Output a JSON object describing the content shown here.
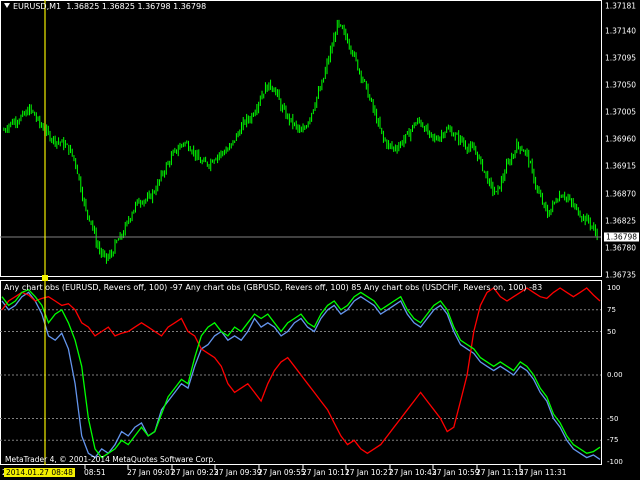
{
  "chart_header": {
    "symbol": "EURUSD,M1",
    "ohlc": "1.36825 1.36825 1.36798 1.36798"
  },
  "indicator_header": {
    "text": "Any chart obs (EURUSD, Revers off, 100) -97  Any chart obs (GBPUSD, Revers off, 100) 85  Any chart obs (USDCHF, Revers on, 100) -83"
  },
  "footer": {
    "copyright": "MetaTrader 4, © 2001-2014 MetaQuotes Software Corp."
  },
  "colors": {
    "background": "#000000",
    "grid": "#808080",
    "bull_candle": "#00ff00",
    "crosshair": "#f4f000",
    "eurusd_line": "#6495ed",
    "gbpusd_line": "#ff0000",
    "usdchf_line": "#00ff00"
  },
  "chart_data": [
    {
      "type": "candlestick",
      "title": "",
      "y_ticks": [
        "1.37181",
        "1.37140",
        "1.37095",
        "1.37050",
        "1.37005",
        "1.36960",
        "1.36915",
        "1.36870",
        "1.36825",
        "1.36780",
        "1.36735"
      ],
      "current_price": "1.36798",
      "ylim": [
        1.36735,
        1.37181
      ],
      "close_path": [
        1.36975,
        1.36985,
        1.3699,
        1.36995,
        1.37,
        1.3701,
        1.37,
        1.36985,
        1.36975,
        1.36965,
        1.36958,
        1.36955,
        1.3695,
        1.3694,
        1.3692,
        1.3688,
        1.3684,
        1.36825,
        1.3679,
        1.3677,
        1.36762,
        1.3677,
        1.3679,
        1.368,
        1.3682,
        1.3684,
        1.36855,
        1.3686,
        1.3686,
        1.3687,
        1.36885,
        1.36905,
        1.3692,
        1.36935,
        1.36945,
        1.36955,
        1.3695,
        1.3694,
        1.36925,
        1.3692,
        1.3692,
        1.3693,
        1.36935,
        1.3694,
        1.36945,
        1.3696,
        1.36975,
        1.3699,
        1.36995,
        1.3701,
        1.3703,
        1.37045,
        1.3705,
        1.3704,
        1.37015,
        1.37,
        1.3699,
        1.3698,
        1.3697,
        1.36985,
        1.37005,
        1.3703,
        1.3705,
        1.37085,
        1.37115,
        1.3715,
        1.3714,
        1.37125,
        1.37105,
        1.3708,
        1.3706,
        1.37035,
        1.3701,
        1.36985,
        1.3696,
        1.3695,
        1.36945,
        1.3695,
        1.3696,
        1.3697,
        1.36985,
        1.3699,
        1.3698,
        1.36965,
        1.3696,
        1.36965,
        1.36975,
        1.36975,
        1.36965,
        1.3696,
        1.3695,
        1.36945,
        1.3694,
        1.3692,
        1.369,
        1.3688,
        1.3687,
        1.3689,
        1.36915,
        1.3693,
        1.3695,
        1.36945,
        1.36935,
        1.36905,
        1.36875,
        1.36855,
        1.36835,
        1.3685,
        1.36865,
        1.3687,
        1.3686,
        1.3685,
        1.3684,
        1.3683,
        1.36825,
        1.3681,
        1.36798
      ]
    },
    {
      "type": "line",
      "title": "",
      "y_ticks": [
        "100",
        "75",
        "50",
        "0.00",
        "-50",
        "-75",
        "-100"
      ],
      "ylim": [
        -100,
        100
      ],
      "series": [
        {
          "name": "Any chart obs (EURUSD, Revers off, 100)",
          "values": [
            85,
            75,
            80,
            90,
            95,
            85,
            70,
            45,
            40,
            48,
            30,
            -10,
            -70,
            -90,
            -95,
            -85,
            -90,
            -80,
            -65,
            -70,
            -60,
            -55,
            -70,
            -65,
            -40,
            -30,
            -20,
            -10,
            -15,
            10,
            30,
            35,
            45,
            50,
            40,
            45,
            40,
            50,
            65,
            55,
            60,
            55,
            45,
            50,
            60,
            65,
            55,
            50,
            65,
            75,
            80,
            70,
            75,
            85,
            90,
            85,
            80,
            70,
            75,
            80,
            85,
            70,
            60,
            55,
            65,
            75,
            80,
            70,
            50,
            35,
            30,
            25,
            15,
            10,
            5,
            10,
            5,
            0,
            10,
            5,
            -5,
            -20,
            -30,
            -50,
            -60,
            -75,
            -85,
            -90,
            -95,
            -92,
            -97
          ]
        },
        {
          "name": "Any chart obs (GBPUSD, Revers off, 100)",
          "values": [
            75,
            85,
            90,
            95,
            92,
            85,
            88,
            90,
            85,
            80,
            82,
            75,
            60,
            55,
            45,
            50,
            55,
            45,
            48,
            50,
            55,
            60,
            55,
            50,
            45,
            55,
            60,
            65,
            50,
            45,
            30,
            25,
            20,
            10,
            -10,
            -20,
            -15,
            -10,
            -20,
            -30,
            -10,
            5,
            15,
            20,
            10,
            0,
            -10,
            -20,
            -30,
            -40,
            -55,
            -70,
            -80,
            -75,
            -85,
            -90,
            -85,
            -80,
            -70,
            -60,
            -50,
            -40,
            -30,
            -20,
            -30,
            -40,
            -50,
            -65,
            -60,
            -30,
            0,
            50,
            80,
            95,
            100,
            90,
            85,
            90,
            95,
            100,
            95,
            90,
            88,
            95,
            100,
            95,
            90,
            95,
            100,
            92,
            85
          ]
        },
        {
          "name": "Any chart obs (USDCHF, Revers on, 100)",
          "values": [
            90,
            80,
            85,
            95,
            98,
            90,
            80,
            60,
            70,
            75,
            60,
            40,
            10,
            -50,
            -85,
            -95,
            -90,
            -85,
            -75,
            -80,
            -70,
            -60,
            -70,
            -65,
            -45,
            -25,
            -15,
            -5,
            -10,
            20,
            45,
            55,
            60,
            50,
            45,
            55,
            50,
            60,
            70,
            65,
            70,
            60,
            50,
            60,
            65,
            70,
            60,
            55,
            70,
            80,
            85,
            75,
            80,
            90,
            95,
            90,
            85,
            75,
            80,
            85,
            90,
            75,
            65,
            60,
            70,
            80,
            85,
            75,
            55,
            40,
            35,
            30,
            20,
            15,
            10,
            15,
            10,
            5,
            15,
            10,
            0,
            -15,
            -25,
            -45,
            -55,
            -70,
            -80,
            -85,
            -90,
            -88,
            -83
          ]
        }
      ]
    }
  ],
  "time_axis": [
    "27",
    "2014.01.27 08:48",
    "08:51",
    "27 Jan 09:07",
    "27 Jan 09:23",
    "27 Jan 09:39",
    "27 Jan 09:55",
    "27 Jan 10:11",
    "27 Jan 10:27",
    "27 Jan 10:43",
    "27 Jan 10:59",
    "27 Jan 11:15",
    "27 Jan 11:31"
  ]
}
